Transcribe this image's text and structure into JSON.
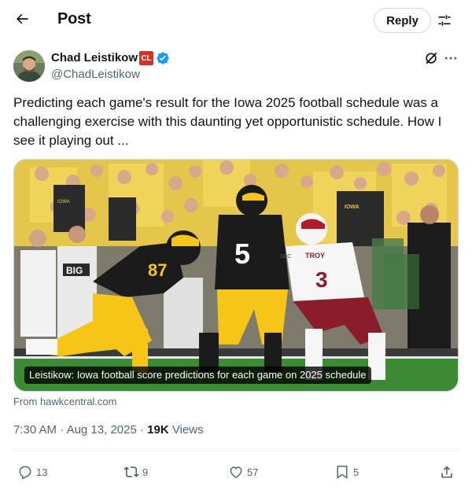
{
  "header": {
    "title": "Post",
    "reply_label": "Reply"
  },
  "author": {
    "name": "Chad Leistikow",
    "badge": "CL",
    "handle": "@ChadLeistikow"
  },
  "tweet": {
    "text": "Predicting each game's result for the Iowa 2025 football schedule was a challenging exercise with this daunting yet opportunistic schedule. How I see it playing out ..."
  },
  "card": {
    "caption": "Leistikow: Iowa football score predictions for each game on 2025 schedule",
    "source": "From hawkcentral.com",
    "photo_labels": {
      "jersey_left": "87",
      "jersey_center": "5",
      "jersey_right": "3",
      "big_ten": "BIG",
      "troy": "TROY",
      "sbc": "SBC",
      "fan_sign_1": "IOWA",
      "fan_sign_2": "IOWA"
    }
  },
  "meta": {
    "time": "7:30 AM",
    "date": "Aug 13, 2025",
    "views_count": "19K",
    "views_label": "Views"
  },
  "actions": {
    "replies": "13",
    "reposts": "9",
    "likes": "57",
    "bookmarks": "5"
  },
  "colors": {
    "text_primary": "#0f1419",
    "text_secondary": "#536471",
    "verified_blue": "#1d9bf0",
    "badge_red": "#d93025",
    "divider": "#eff3f4",
    "iowa_gold": "#f5c518",
    "iowa_black": "#1b1b1b",
    "troy_maroon": "#8a1c2b"
  },
  "icons": {
    "back": "arrow-left-icon",
    "filter": "sliders-icon",
    "verified": "verified-badge-icon",
    "grok": "grok-icon",
    "more": "more-dots-icon",
    "reply": "reply-icon",
    "repost": "repost-icon",
    "like": "heart-icon",
    "bookmark": "bookmark-icon",
    "share": "share-icon"
  }
}
